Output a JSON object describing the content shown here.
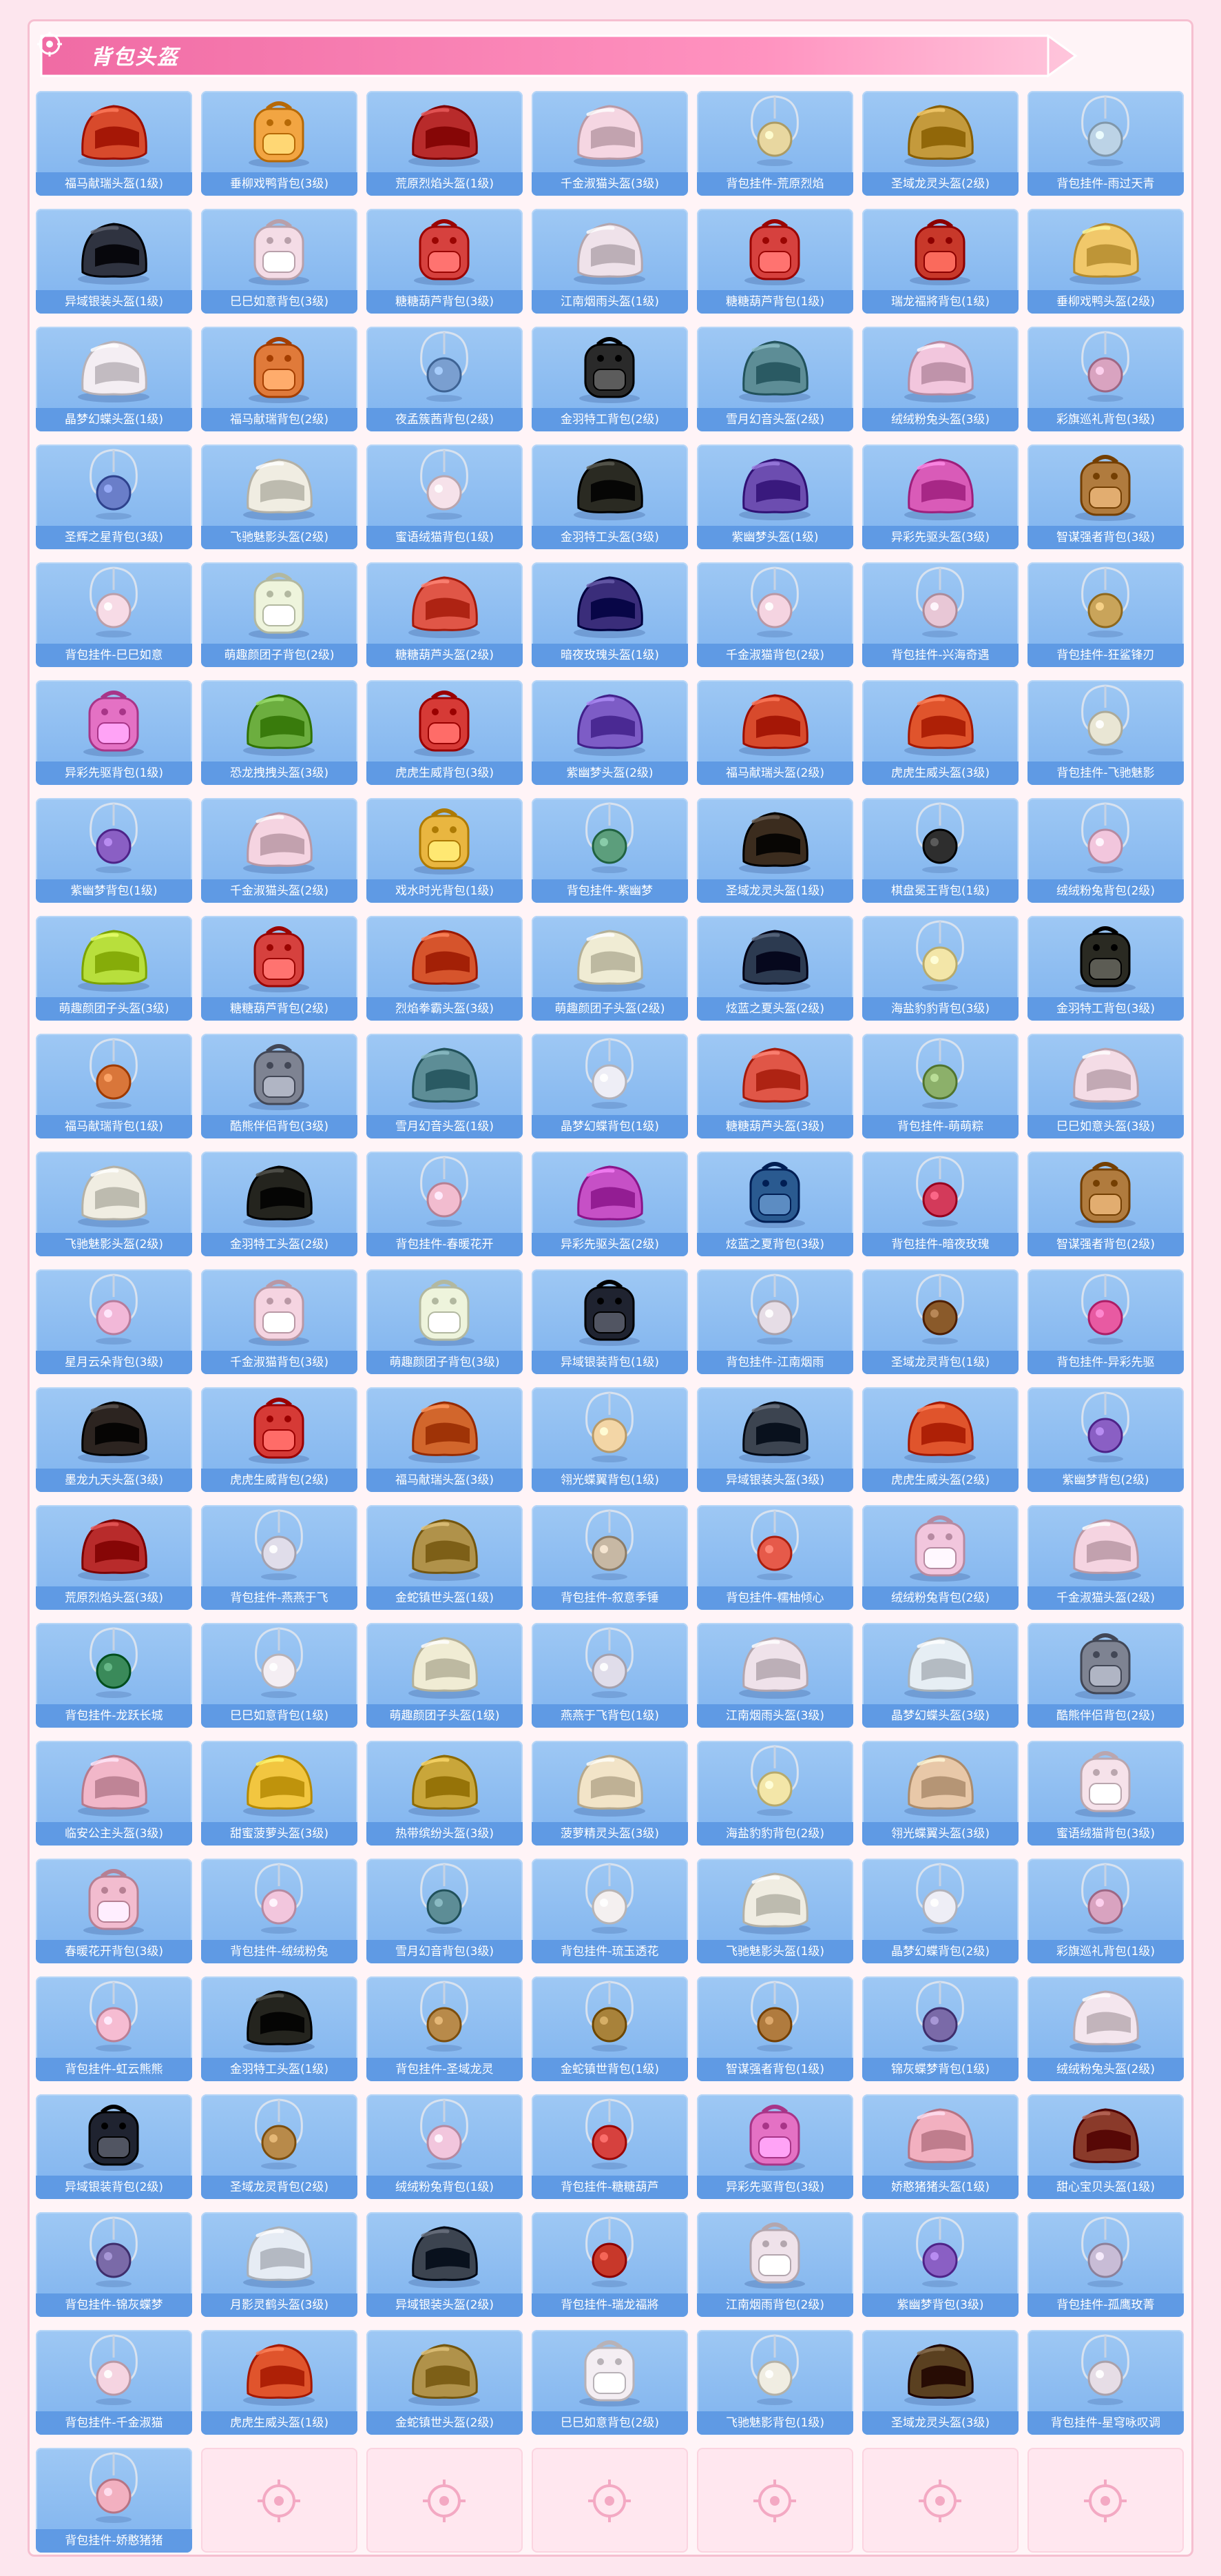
{
  "header": {
    "title": "背包头盔",
    "accent": "#f06ba4",
    "accent_light": "#ff9fc6"
  },
  "colors": {
    "card_bg": "#8fbef1",
    "caption_bg": "#5f9ae4",
    "empty_card_bg": "#ffe7ef",
    "page_bg": "#fde6ee"
  },
  "items": [
    {
      "label": "福马献瑞头盔(1级)",
      "icon": "helmet-icon",
      "color": "#d84a2c"
    },
    {
      "label": "垂柳戏鸭背包(3级)",
      "icon": "backpack-icon",
      "color": "#f2a542"
    },
    {
      "label": "荒原烈焰头盔(1级)",
      "icon": "helmet-icon",
      "color": "#b82b2b"
    },
    {
      "label": "千金淑猫头盔(3级)",
      "icon": "helmet-icon",
      "color": "#f5d6e2"
    },
    {
      "label": "背包挂件-荒原烈焰",
      "icon": "charm-icon",
      "color": "#e8d7a0"
    },
    {
      "label": "圣域龙灵头盔(2级)",
      "icon": "helmet-icon",
      "color": "#c49a3c"
    },
    {
      "label": "背包挂件-雨过天青",
      "icon": "charm-icon",
      "color": "#bcd3e6"
    },
    {
      "label": "异域银装头盔(1级)",
      "icon": "helmet-icon",
      "color": "#2f3340"
    },
    {
      "label": "巳巳如意背包(3级)",
      "icon": "backpack-icon",
      "color": "#f4dce6"
    },
    {
      "label": "糖糖葫芦背包(3级)",
      "icon": "backpack-icon",
      "color": "#d6413e"
    },
    {
      "label": "江南烟雨头盔(1级)",
      "icon": "helmet-icon",
      "color": "#efe2ea"
    },
    {
      "label": "糖糖葫芦背包(1级)",
      "icon": "backpack-icon",
      "color": "#d6413e"
    },
    {
      "label": "瑞龙福將背包(1级)",
      "icon": "backpack-icon",
      "color": "#c8382a"
    },
    {
      "label": "垂柳戏鸭头盔(2级)",
      "icon": "helmet-icon",
      "color": "#f1c86a"
    },
    {
      "label": "晶梦幻蝶头盔(1级)",
      "icon": "helmet-icon",
      "color": "#f4eef3"
    },
    {
      "label": "福马献瑞背包(2级)",
      "icon": "backpack-icon",
      "color": "#e07a3a"
    },
    {
      "label": "夜孟簇茜背包(2级)",
      "icon": "charm-icon",
      "color": "#7a9fd0"
    },
    {
      "label": "金羽特工背包(2级)",
      "icon": "backpack-icon",
      "color": "#2a2a2a"
    },
    {
      "label": "雪月幻音头盔(2级)",
      "icon": "helmet-icon",
      "color": "#5d8d96"
    },
    {
      "label": "绒绒粉兔头盔(3级)",
      "icon": "helmet-icon",
      "color": "#f2c6dd"
    },
    {
      "label": "彩旗巡礼背包(3级)",
      "icon": "charm-icon",
      "color": "#d9a3c0"
    },
    {
      "label": "圣辉之星背包(3级)",
      "icon": "charm-icon",
      "color": "#6a7ec9"
    },
    {
      "label": "飞驰魅影头盔(2级)",
      "icon": "helmet-icon",
      "color": "#f0ede2"
    },
    {
      "label": "蜜语绒猫背包(1级)",
      "icon": "charm-icon",
      "color": "#f6e2ea"
    },
    {
      "label": "金羽特工头盔(3级)",
      "icon": "helmet-icon",
      "color": "#2a2a22"
    },
    {
      "label": "紫幽梦头盔(1级)",
      "icon": "helmet-icon",
      "color": "#6c4db0"
    },
    {
      "label": "异彩先驱头盔(3级)",
      "icon": "helmet-icon",
      "color": "#d95bb8"
    },
    {
      "label": "智谋强者背包(3级)",
      "icon": "backpack-icon",
      "color": "#b07b3e"
    },
    {
      "label": "背包挂件-巳巳如意",
      "icon": "charm-icon",
      "color": "#f7dbe6"
    },
    {
      "label": "萌趣颜团子背包(2级)",
      "icon": "backpack-icon",
      "color": "#eef4dc"
    },
    {
      "label": "糖糖葫芦头盔(2级)",
      "icon": "helmet-icon",
      "color": "#e05647"
    },
    {
      "label": "暗夜玫瑰头盔(1级)",
      "icon": "helmet-icon",
      "color": "#3a2d7a"
    },
    {
      "label": "千金淑猫背包(2级)",
      "icon": "charm-icon",
      "color": "#f5d4e1"
    },
    {
      "label": "背包挂件-兴海奇遇",
      "icon": "charm-icon",
      "color": "#e8c7d6"
    },
    {
      "label": "背包挂件-狂鲨锋刃",
      "icon": "charm-icon",
      "color": "#c9a45a"
    },
    {
      "label": "异彩先驱背包(1级)",
      "icon": "backpack-icon",
      "color": "#e471c4"
    },
    {
      "label": "恐龙拽拽头盔(3级)",
      "icon": "helmet-icon",
      "color": "#6cae3f"
    },
    {
      "label": "虎虎生威背包(3级)",
      "icon": "backpack-icon",
      "color": "#d63a36"
    },
    {
      "label": "紫幽梦头盔(2级)",
      "icon": "helmet-icon",
      "color": "#7d5cc6"
    },
    {
      "label": "福马献瑞头盔(2级)",
      "icon": "helmet-icon",
      "color": "#d84a2c"
    },
    {
      "label": "虎虎生威头盔(3级)",
      "icon": "helmet-icon",
      "color": "#e0542c"
    },
    {
      "label": "背包挂件-飞驰魅影",
      "icon": "charm-icon",
      "color": "#e9e6d4"
    },
    {
      "label": "紫幽梦背包(1级)",
      "icon": "charm-icon",
      "color": "#8a5fc4"
    },
    {
      "label": "千金淑猫头盔(2级)",
      "icon": "helmet-icon",
      "color": "#f5d4e1"
    },
    {
      "label": "戏水时光背包(1级)",
      "icon": "backpack-icon",
      "color": "#e9b640"
    },
    {
      "label": "背包挂件-紫幽梦",
      "icon": "charm-icon",
      "color": "#5c9e7c"
    },
    {
      "label": "圣域龙灵头盔(1级)",
      "icon": "helmet-icon",
      "color": "#3b2c1e"
    },
    {
      "label": "棋盘冕王背包(1级)",
      "icon": "charm-icon",
      "color": "#2e2e2e"
    },
    {
      "label": "绒绒粉兔背包(2级)",
      "icon": "charm-icon",
      "color": "#f2c6dd"
    },
    {
      "label": "萌趣颜团子头盔(3级)",
      "icon": "helmet-icon",
      "color": "#b8df3c"
    },
    {
      "label": "糖糖葫芦背包(2级)",
      "icon": "backpack-icon",
      "color": "#d6413e"
    },
    {
      "label": "烈焰拳霸头盔(3级)",
      "icon": "helmet-icon",
      "color": "#d6542c"
    },
    {
      "label": "萌趣颜团子头盔(2级)",
      "icon": "helmet-icon",
      "color": "#f0ecd4"
    },
    {
      "label": "炫蓝之夏头盔(2级)",
      "icon": "helmet-icon",
      "color": "#2c3a50"
    },
    {
      "label": "海盐豹豹背包(3级)",
      "icon": "charm-icon",
      "color": "#f3e6a8"
    },
    {
      "label": "金羽特工背包(3级)",
      "icon": "backpack-icon",
      "color": "#2a2a22"
    },
    {
      "label": "福马献瑞背包(1级)",
      "icon": "charm-icon",
      "color": "#d9763a"
    },
    {
      "label": "酷熊伴侣背包(3级)",
      "icon": "backpack-icon",
      "color": "#7e8392"
    },
    {
      "label": "雪月幻音头盔(1级)",
      "icon": "helmet-icon",
      "color": "#5d8d96"
    },
    {
      "label": "晶梦幻蝶背包(1级)",
      "icon": "charm-icon",
      "color": "#eeeef6"
    },
    {
      "label": "糖糖葫芦头盔(3级)",
      "icon": "helmet-icon",
      "color": "#e05647"
    },
    {
      "label": "背包挂件-萌萌粽",
      "icon": "charm-icon",
      "color": "#8cb06a"
    },
    {
      "label": "巳巳如意头盔(3级)",
      "icon": "helmet-icon",
      "color": "#f4dce6"
    },
    {
      "label": "飞驰魅影头盔(2级)",
      "icon": "helmet-icon",
      "color": "#f0ede2"
    },
    {
      "label": "金羽特工头盔(2级)",
      "icon": "helmet-icon",
      "color": "#24241e"
    },
    {
      "label": "背包挂件-春暖花开",
      "icon": "charm-icon",
      "color": "#f2bccf"
    },
    {
      "label": "异彩先驱头盔(2级)",
      "icon": "helmet-icon",
      "color": "#c650c6"
    },
    {
      "label": "炫蓝之夏背包(3级)",
      "icon": "backpack-icon",
      "color": "#2a5a90"
    },
    {
      "label": "背包挂件-暗夜玫瑰",
      "icon": "charm-icon",
      "color": "#d33a5a"
    },
    {
      "label": "智谋强者背包(2级)",
      "icon": "backpack-icon",
      "color": "#b07b3e"
    },
    {
      "label": "星月云朵背包(3级)",
      "icon": "charm-icon",
      "color": "#f2b8d8"
    },
    {
      "label": "千金淑猫背包(3级)",
      "icon": "backpack-icon",
      "color": "#f5d4e1"
    },
    {
      "label": "萌趣颜团子背包(3级)",
      "icon": "backpack-icon",
      "color": "#eef4dc"
    },
    {
      "label": "异域银装背包(1级)",
      "icon": "backpack-icon",
      "color": "#1f2330"
    },
    {
      "label": "背包挂件-江南烟雨",
      "icon": "charm-icon",
      "color": "#e6dde6"
    },
    {
      "label": "圣域龙灵背包(1级)",
      "icon": "charm-icon",
      "color": "#8a5a2a"
    },
    {
      "label": "背包挂件-异彩先驱",
      "icon": "charm-icon",
      "color": "#e85aa2"
    },
    {
      "label": "墨龙九天头盔(3级)",
      "icon": "helmet-icon",
      "color": "#2c2420"
    },
    {
      "label": "虎虎生威背包(2级)",
      "icon": "backpack-icon",
      "color": "#d63a36"
    },
    {
      "label": "福马献瑞头盔(3级)",
      "icon": "helmet-icon",
      "color": "#d2662c"
    },
    {
      "label": "翎光蝶翼背包(1级)",
      "icon": "charm-icon",
      "color": "#f3d6a6"
    },
    {
      "label": "异域银装头盔(3级)",
      "icon": "helmet-icon",
      "color": "#3c4450"
    },
    {
      "label": "虎虎生威头盔(2级)",
      "icon": "helmet-icon",
      "color": "#e0542c"
    },
    {
      "label": "紫幽梦背包(2级)",
      "icon": "charm-icon",
      "color": "#8a5fc4"
    },
    {
      "label": "荒原烈焰头盔(3级)",
      "icon": "helmet-icon",
      "color": "#b82b2b"
    },
    {
      "label": "背包挂件-燕燕于飞",
      "icon": "charm-icon",
      "color": "#e0ddea"
    },
    {
      "label": "金蛇镇世头盔(1级)",
      "icon": "helmet-icon",
      "color": "#b0924a"
    },
    {
      "label": "背包挂件-叙意季锤",
      "icon": "charm-icon",
      "color": "#c7b8a4"
    },
    {
      "label": "背包挂件-糯柚倾心",
      "icon": "charm-icon",
      "color": "#e65a4a"
    },
    {
      "label": "绒绒粉兔背包(2级)",
      "icon": "backpack-icon",
      "color": "#f2c6dd"
    },
    {
      "label": "千金淑猫头盔(2级)",
      "icon": "helmet-icon",
      "color": "#f5d4e1"
    },
    {
      "label": "背包挂件-龙跃长城",
      "icon": "charm-icon",
      "color": "#3a8a5a"
    },
    {
      "label": "巳巳如意背包(1级)",
      "icon": "charm-icon",
      "color": "#f4eef3"
    },
    {
      "label": "萌趣颜团子头盔(1级)",
      "icon": "helmet-icon",
      "color": "#f0ecd4"
    },
    {
      "label": "燕燕于飞背包(1级)",
      "icon": "charm-icon",
      "color": "#e0ddea"
    },
    {
      "label": "江南烟雨头盔(3级)",
      "icon": "helmet-icon",
      "color": "#efe2ea"
    },
    {
      "label": "晶梦幻蝶头盔(3级)",
      "icon": "helmet-icon",
      "color": "#e6eef4"
    },
    {
      "label": "酷熊伴侣背包(2级)",
      "icon": "backpack-icon",
      "color": "#7e8392"
    },
    {
      "label": "临安公主头盔(3级)",
      "icon": "helmet-icon",
      "color": "#f2b7c9"
    },
    {
      "label": "甜蜜菠萝头盔(3级)",
      "icon": "helmet-icon",
      "color": "#f2c640"
    },
    {
      "label": "热带缤纷头盔(3级)",
      "icon": "helmet-icon",
      "color": "#c9a63a"
    },
    {
      "label": "菠萝精灵头盔(3级)",
      "icon": "helmet-icon",
      "color": "#f2e4c8"
    },
    {
      "label": "海盐豹豹背包(2级)",
      "icon": "charm-icon",
      "color": "#f3e6a8"
    },
    {
      "label": "翎光蝶翼头盔(3级)",
      "icon": "helmet-icon",
      "color": "#e8c8a8"
    },
    {
      "label": "蜜语绒猫背包(3级)",
      "icon": "backpack-icon",
      "color": "#f6e2ea"
    },
    {
      "label": "春暖花开背包(3级)",
      "icon": "backpack-icon",
      "color": "#f2bccf"
    },
    {
      "label": "背包挂件-绒绒粉兔",
      "icon": "charm-icon",
      "color": "#f2c6dd"
    },
    {
      "label": "雪月幻音背包(3级)",
      "icon": "charm-icon",
      "color": "#5d8d96"
    },
    {
      "label": "背包挂件-琉玉透花",
      "icon": "charm-icon",
      "color": "#f4f0f0"
    },
    {
      "label": "飞驰魅影头盔(1级)",
      "icon": "helmet-icon",
      "color": "#f0ede2"
    },
    {
      "label": "晶梦幻蝶背包(2级)",
      "icon": "charm-icon",
      "color": "#eeeef6"
    },
    {
      "label": "彩旗巡礼背包(1级)",
      "icon": "charm-icon",
      "color": "#d9a3c0"
    },
    {
      "label": "背包挂件-虹云熊熊",
      "icon": "charm-icon",
      "color": "#f6bcd2"
    },
    {
      "label": "金羽特工头盔(1级)",
      "icon": "helmet-icon",
      "color": "#24241e"
    },
    {
      "label": "背包挂件-圣域龙灵",
      "icon": "charm-icon",
      "color": "#b88a4a"
    },
    {
      "label": "金蛇镇世背包(1级)",
      "icon": "charm-icon",
      "color": "#a8823a"
    },
    {
      "label": "智谋强者背包(1级)",
      "icon": "charm-icon",
      "color": "#b07b3e"
    },
    {
      "label": "锦灰蝶梦背包(1级)",
      "icon": "charm-icon",
      "color": "#7a6aa8"
    },
    {
      "label": "绒绒粉兔头盔(2级)",
      "icon": "helmet-icon",
      "color": "#f4e6ee"
    },
    {
      "label": "异域银装背包(2级)",
      "icon": "backpack-icon",
      "color": "#1f2330"
    },
    {
      "label": "圣域龙灵背包(2级)",
      "icon": "charm-icon",
      "color": "#b88a4a"
    },
    {
      "label": "绒绒粉兔背包(1级)",
      "icon": "charm-icon",
      "color": "#f2c6dd"
    },
    {
      "label": "背包挂件-糖糖葫芦",
      "icon": "charm-icon",
      "color": "#d6413e"
    },
    {
      "label": "异彩先驱背包(3级)",
      "icon": "backpack-icon",
      "color": "#e471c4"
    },
    {
      "label": "娇憨猪猪头盔(1级)",
      "icon": "helmet-icon",
      "color": "#f2b0c0"
    },
    {
      "label": "甜心宝贝头盔(1级)",
      "icon": "helmet-icon",
      "color": "#8a3a2a"
    },
    {
      "label": "背包挂件-锦灰蝶梦",
      "icon": "charm-icon",
      "color": "#7a6aa8"
    },
    {
      "label": "月影灵鹤头盔(3级)",
      "icon": "helmet-icon",
      "color": "#e6ecf4"
    },
    {
      "label": "异域银装头盔(2级)",
      "icon": "helmet-icon",
      "color": "#3c4450"
    },
    {
      "label": "背包挂件-瑞龙福將",
      "icon": "charm-icon",
      "color": "#c8382a"
    },
    {
      "label": "江南烟雨背包(2级)",
      "icon": "backpack-icon",
      "color": "#efe2ea"
    },
    {
      "label": "紫幽梦背包(3级)",
      "icon": "charm-icon",
      "color": "#8a5fc4"
    },
    {
      "label": "背包挂件-孤鹰玫菁",
      "icon": "charm-icon",
      "color": "#c8bcd6"
    },
    {
      "label": "背包挂件-千金淑猫",
      "icon": "charm-icon",
      "color": "#f5d4e1"
    },
    {
      "label": "虎虎生威头盔(1级)",
      "icon": "helmet-icon",
      "color": "#e0542c"
    },
    {
      "label": "金蛇镇世头盔(2级)",
      "icon": "helmet-icon",
      "color": "#b0924a"
    },
    {
      "label": "巳巳如意背包(2级)",
      "icon": "backpack-icon",
      "color": "#f4eef3"
    },
    {
      "label": "飞驰魅影背包(1级)",
      "icon": "charm-icon",
      "color": "#f0ede2"
    },
    {
      "label": "圣域龙灵头盔(3级)",
      "icon": "helmet-icon",
      "color": "#5a4020"
    },
    {
      "label": "背包挂件-星穹咏叹调",
      "icon": "charm-icon",
      "color": "#e6dde6"
    },
    {
      "label": "背包挂件-娇憨猪猪",
      "icon": "charm-icon",
      "color": "#f2b0c0"
    }
  ],
  "empty_slots": 6,
  "empty_slot_icon": "crosshair-icon"
}
